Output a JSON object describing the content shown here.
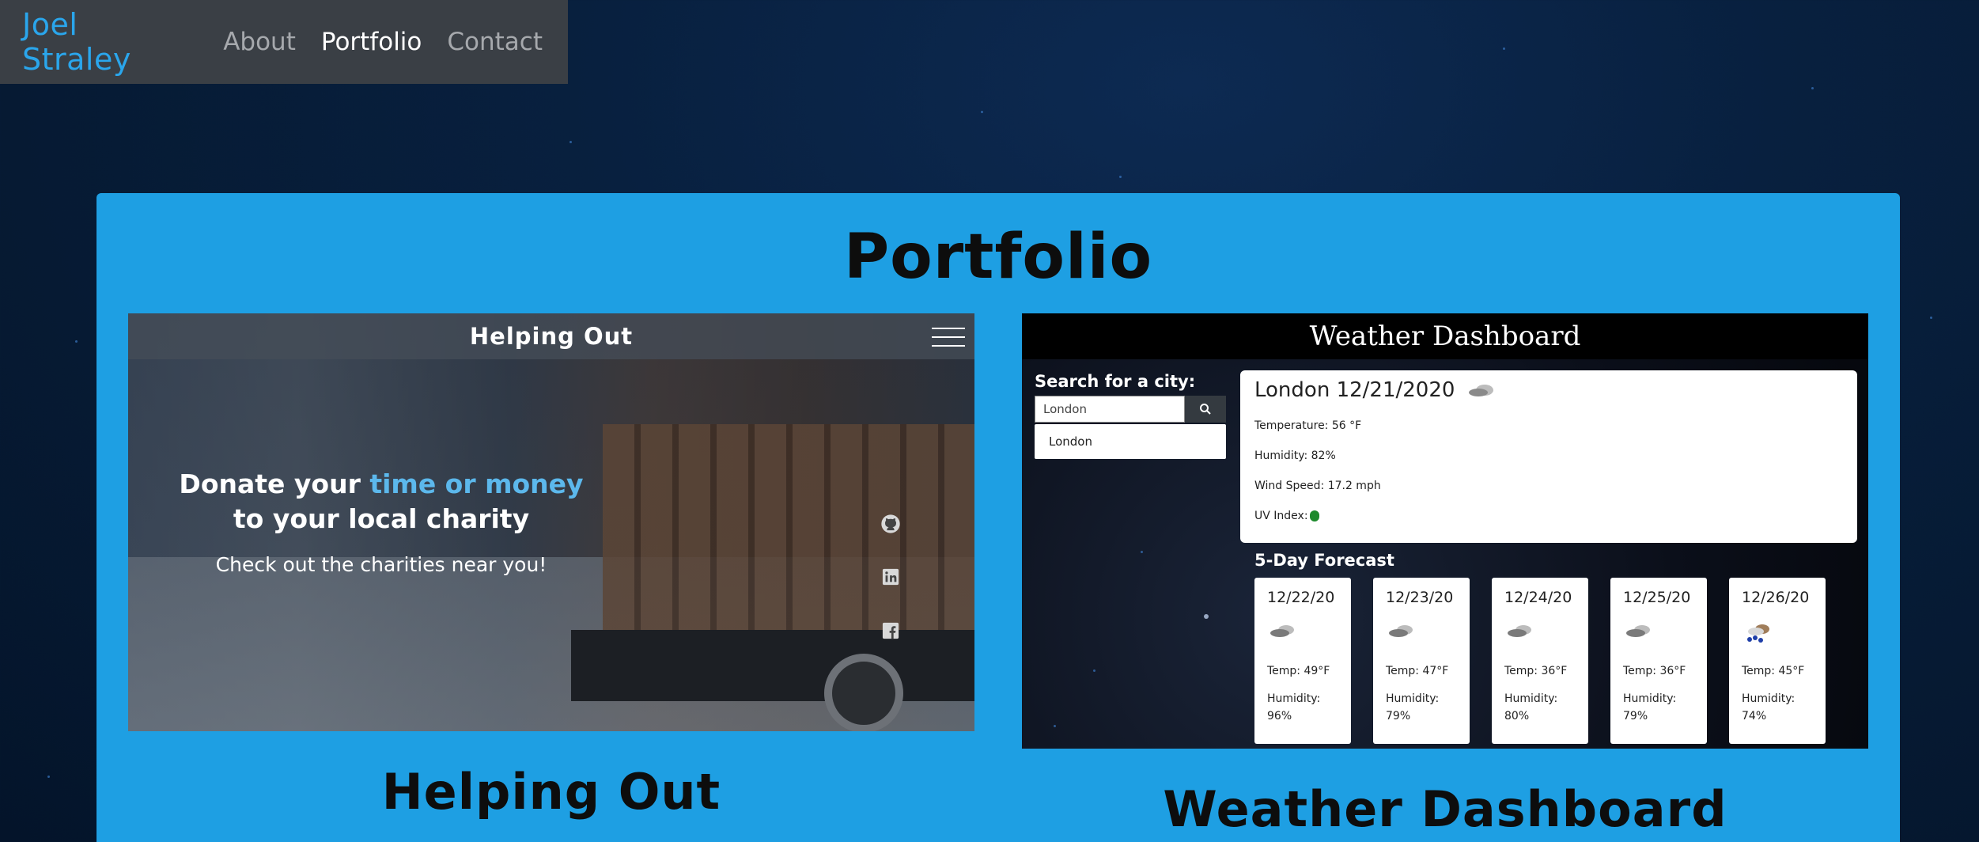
{
  "nav": {
    "brand": "Joel Straley",
    "links": [
      {
        "label": "About"
      },
      {
        "label": "Portfolio"
      },
      {
        "label": "Contact"
      }
    ],
    "active": "Portfolio"
  },
  "portfolio": {
    "title": "Portfolio",
    "projects": [
      {
        "title": "Helping Out",
        "screenshot": {
          "header": "Helping Out",
          "hero_line1_prefix": "Donate your",
          "hero_line1_accent": "time or money",
          "hero_line2": "to your local charity",
          "hero_sub": "Check out the charities near you!",
          "icons": [
            "github-icon",
            "linkedin-icon",
            "facebook-icon"
          ]
        }
      },
      {
        "title": "Weather Dashboard",
        "screenshot": {
          "header": "Weather Dashboard",
          "search_label": "Search for a city:",
          "search_value": "London",
          "history_item": "London",
          "current": {
            "heading": "London 12/21/2020",
            "temperature": "Temperature: 56 °F",
            "humidity": "Humidity: 82%",
            "wind": "Wind Speed: 17.2 mph",
            "uv": "UV Index:"
          },
          "forecast_title": "5-Day Forecast",
          "forecast": [
            {
              "date": "12/22/20",
              "icon": "cloud-icon",
              "temp": "Temp: 49°F",
              "humidity_label": "Humidity:",
              "humidity": "96%"
            },
            {
              "date": "12/23/20",
              "icon": "cloud-icon",
              "temp": "Temp: 47°F",
              "humidity_label": "Humidity:",
              "humidity": "79%"
            },
            {
              "date": "12/24/20",
              "icon": "cloud-icon",
              "temp": "Temp: 36°F",
              "humidity_label": "Humidity:",
              "humidity": "80%"
            },
            {
              "date": "12/25/20",
              "icon": "cloud-icon",
              "temp": "Temp: 36°F",
              "humidity_label": "Humidity:",
              "humidity": "79%"
            },
            {
              "date": "12/26/20",
              "icon": "rain-cloud-icon",
              "temp": "Temp: 45°F",
              "humidity_label": "Humidity:",
              "humidity": "74%"
            }
          ]
        }
      }
    ]
  },
  "colors": {
    "background": "#061a33",
    "nav_bg": "#3a3f45",
    "brand": "#2aa6ec",
    "panel": "#1e9fe3",
    "accent": "#5cb8ec",
    "uv_green": "#1d8a2c"
  }
}
